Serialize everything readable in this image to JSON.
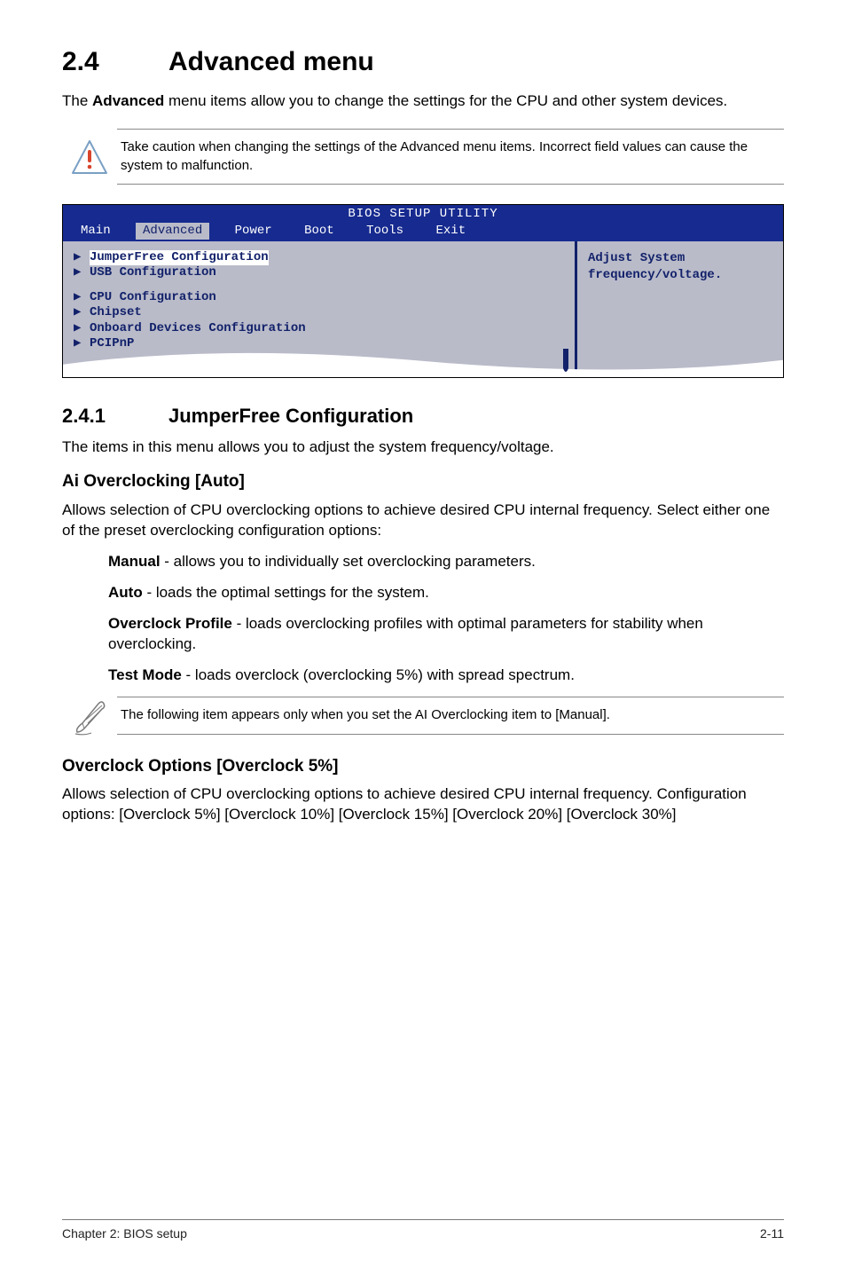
{
  "section": {
    "number": "2.4",
    "title": "Advanced menu",
    "intro_pre": "The ",
    "intro_bold": "Advanced",
    "intro_post": " menu items allow you to change the settings for the CPU and other system devices."
  },
  "caution": {
    "text": "Take caution when changing the settings of the Advanced menu items. Incorrect field values can cause the system to malfunction."
  },
  "bios": {
    "title": "BIOS SETUP UTILITY",
    "tabs": [
      "Main",
      "Advanced",
      "Power",
      "Boot",
      "Tools",
      "Exit"
    ],
    "active_tab_index": 1,
    "left_items": [
      {
        "label": "JumperFree Configuration",
        "highlight": true
      },
      {
        "label": "USB Configuration",
        "highlight": false
      },
      {
        "gap": true
      },
      {
        "label": "CPU Configuration",
        "highlight": false
      },
      {
        "label": "Chipset",
        "highlight": false
      },
      {
        "label": "Onboard Devices Configuration",
        "highlight": false
      },
      {
        "label": "PCIPnP",
        "highlight": false
      }
    ],
    "right_text_line1": "Adjust System",
    "right_text_line2": "frequency/voltage."
  },
  "subsection": {
    "number": "2.4.1",
    "title": "JumperFree Configuration",
    "intro": "The items in this menu allows you to adjust the system frequency/voltage."
  },
  "aioc": {
    "heading": "Ai Overclocking [Auto]",
    "body": "Allows selection of CPU overclocking options to achieve desired CPU internal frequency. Select either one of the preset overclocking configuration options:",
    "opts": [
      {
        "name": "Manual",
        "desc": " - allows you to individually set overclocking parameters."
      },
      {
        "name": "Auto",
        "desc": " - loads the optimal settings for the system."
      },
      {
        "name": "Overclock Profile",
        "desc": " - loads overclocking profiles with optimal parameters for stability when overclocking."
      },
      {
        "name": "Test Mode",
        "desc": " - loads overclock (overclocking 5%) with spread spectrum."
      }
    ]
  },
  "note": {
    "text": "The following item appears only when you set the AI Overclocking item to [Manual]."
  },
  "overclock_options": {
    "heading": "Overclock Options [Overclock 5%]",
    "body": "Allows selection of CPU overclocking options to achieve desired CPU internal frequency. Configuration options: [Overclock 5%] [Overclock 10%] [Overclock 15%] [Overclock 20%] [Overclock 30%]"
  },
  "footer": {
    "left": "Chapter 2: BIOS setup",
    "right": "2-11"
  }
}
